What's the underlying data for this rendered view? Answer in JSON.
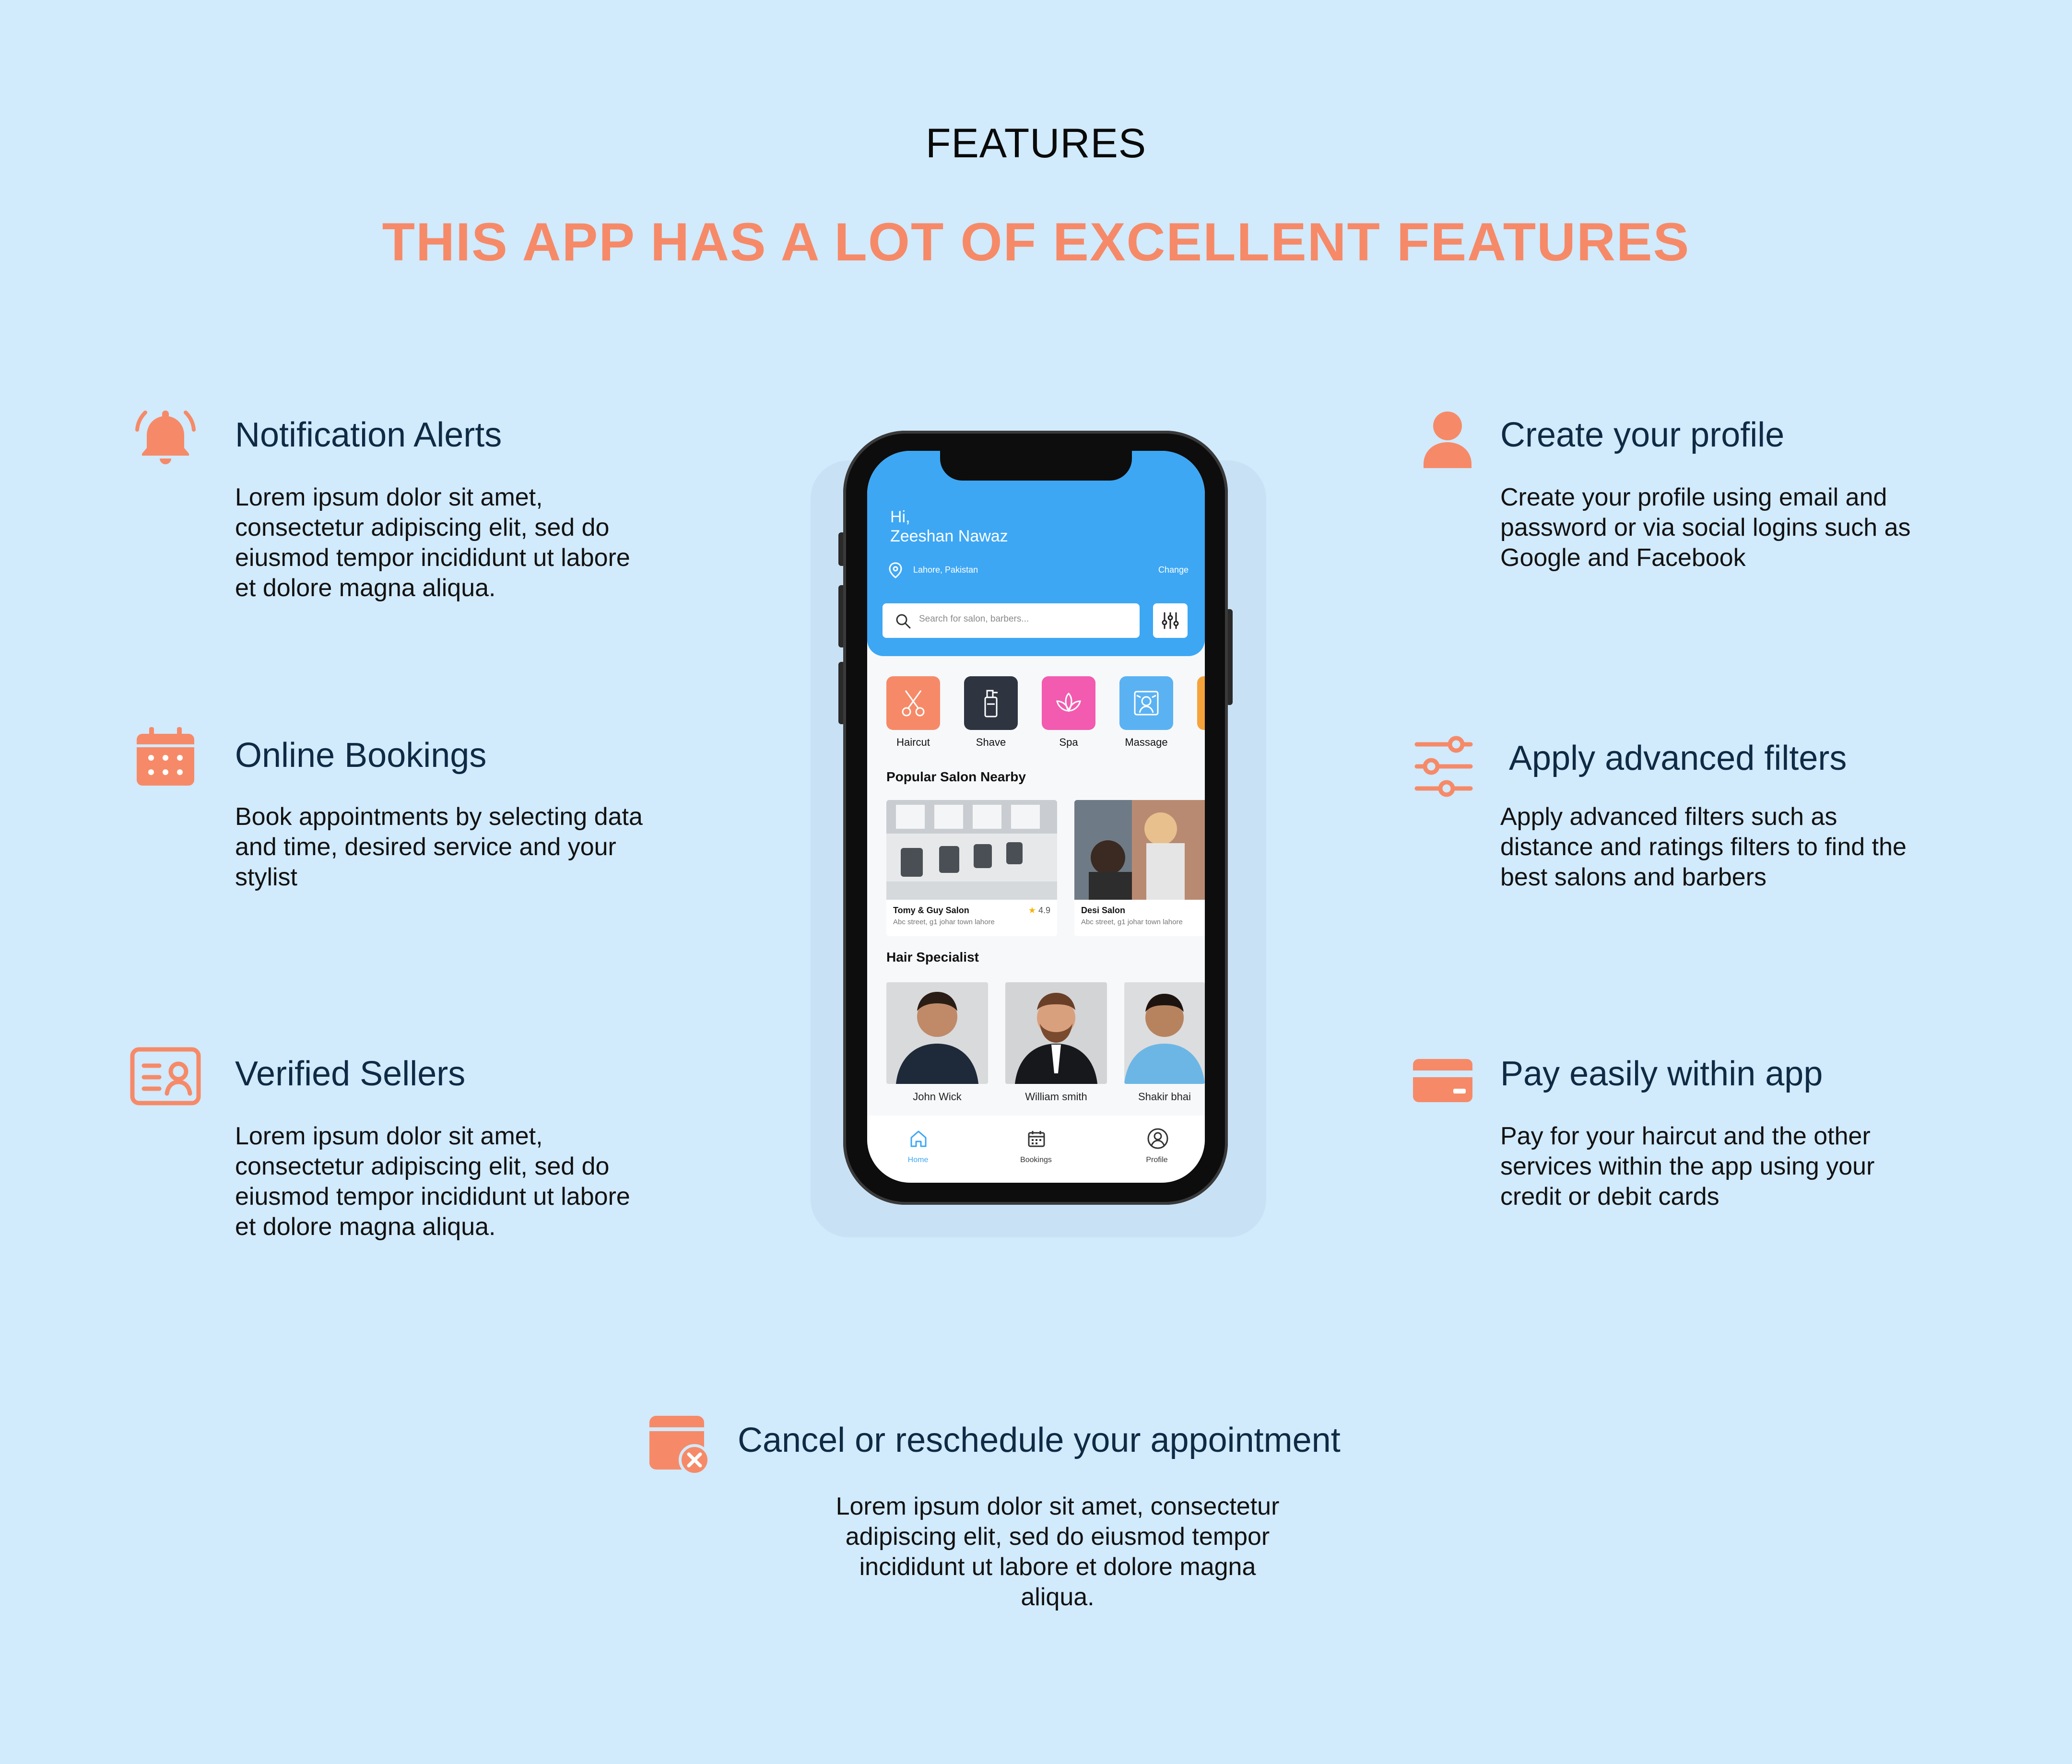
{
  "header": {
    "eyebrow": "FEATURES",
    "headline": "THIS APP HAS A LOT OF EXCELLENT FEATURES"
  },
  "colors": {
    "background": "#D1EAFC",
    "accent": "#F68A68",
    "title": "#0F2A44",
    "app_blue": "#3DA7F4"
  },
  "features": {
    "notification": {
      "icon": "bell-icon",
      "title": "Notification Alerts",
      "desc": [
        "Lorem ipsum dolor sit amet,",
        "consectetur adipiscing elit, sed do",
        "eiusmod tempor incididunt ut labore",
        "et dolore magna aliqua."
      ]
    },
    "bookings": {
      "icon": "calendar-icon",
      "title": "Online Bookings",
      "desc": [
        "Book appointments by selecting data",
        "and time, desired service and your",
        "stylist"
      ]
    },
    "verified": {
      "icon": "id-card-icon",
      "title": "Verified Sellers",
      "desc": [
        "Lorem ipsum dolor sit amet,",
        "consectetur adipiscing elit, sed do",
        "eiusmod tempor incididunt ut labore",
        "et dolore magna aliqua."
      ]
    },
    "profile": {
      "icon": "user-icon",
      "title": "Create your profile",
      "desc": [
        "Create your profile using email and",
        "password or via social logins such as",
        "Google and Facebook"
      ]
    },
    "filters": {
      "icon": "sliders-icon",
      "title": "Apply advanced filters",
      "desc": [
        "Apply advanced filters such as",
        "distance and ratings filters to find the",
        "best salons and barbers"
      ]
    },
    "payment": {
      "icon": "credit-card-icon",
      "title": "Pay easily within app",
      "desc": [
        "Pay for your haircut and the other",
        "services within the app using your",
        "credit or debit cards"
      ]
    },
    "cancel": {
      "icon": "calendar-cancel-icon",
      "title": "Cancel or reschedule your appointment",
      "desc": [
        "Lorem ipsum dolor sit amet, consectetur",
        "adipiscing elit, sed do eiusmod tempor",
        "incididunt ut labore et dolore magna",
        "aliqua."
      ]
    }
  },
  "app": {
    "greeting": "Hi,",
    "user_name": "Zeeshan Nawaz",
    "location": "Lahore, Pakistan",
    "change_label": "Change",
    "search_placeholder": "Search for salon, barbers...",
    "categories": [
      "Haircut",
      "Shave",
      "Spa",
      "Massage"
    ],
    "popular_title": "Popular Salon Nearby",
    "salons": [
      {
        "name": "Tomy & Guy Salon",
        "address": "Abc street, g1 johar town lahore",
        "rating": "4.9"
      },
      {
        "name": "Desi Salon",
        "address": "Abc street, g1 johar town lahore"
      }
    ],
    "specialist_title": "Hair Specialist",
    "specialists": [
      "John Wick",
      "William smith",
      "Shakir bhai"
    ],
    "tabs": [
      "Home",
      "Bookings",
      "Profile"
    ]
  }
}
